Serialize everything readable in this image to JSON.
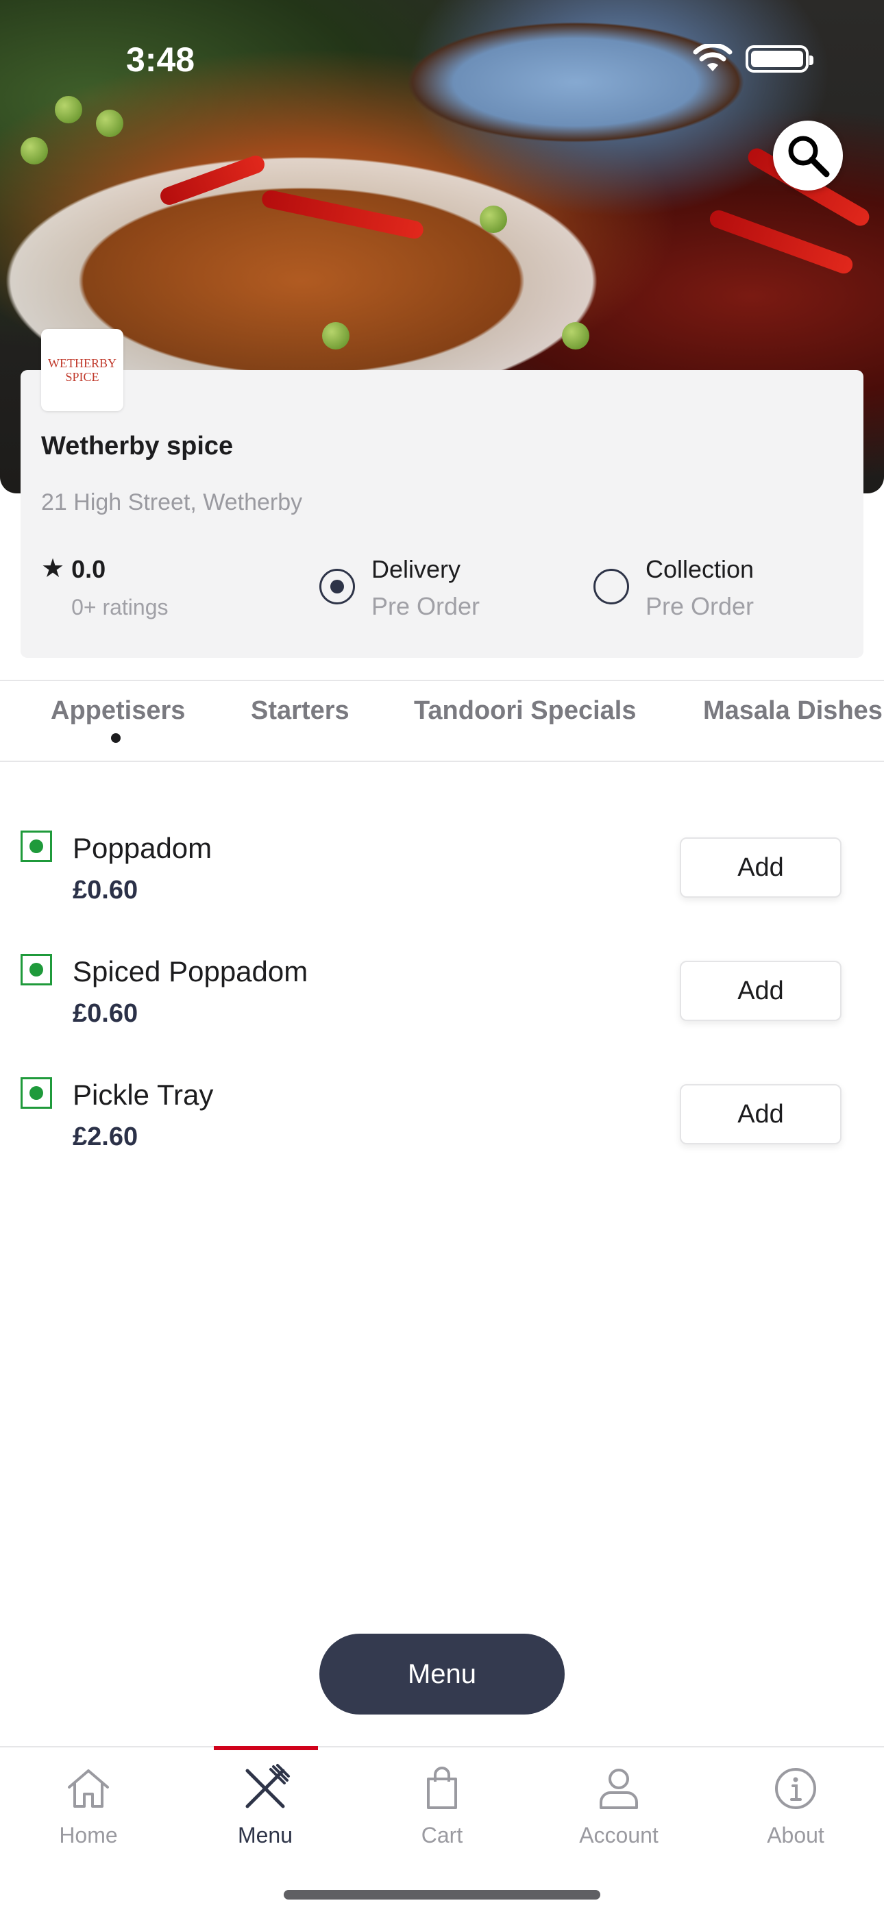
{
  "status_bar": {
    "time": "3:48"
  },
  "restaurant": {
    "logo_text": "WETHERBY SPICE",
    "name": "Wetherby spice",
    "address": "21 High Street, Wetherby",
    "rating_value": "0.0",
    "rating_count": "0+ ratings"
  },
  "order_options": [
    {
      "label": "Delivery",
      "sub": "Pre Order",
      "selected": true
    },
    {
      "label": "Collection",
      "sub": "Pre Order",
      "selected": false
    }
  ],
  "category_tabs": [
    {
      "label": "Appetisers",
      "active": true
    },
    {
      "label": "Starters",
      "active": false
    },
    {
      "label": "Tandoori Specials",
      "active": false
    },
    {
      "label": "Masala Dishes",
      "active": false
    }
  ],
  "menu_items": [
    {
      "name": "Poppadom",
      "price": "£0.60",
      "button": "Add"
    },
    {
      "name": "Spiced Poppadom",
      "price": "£0.60",
      "button": "Add"
    },
    {
      "name": "Pickle Tray",
      "price": "£2.60",
      "button": "Add"
    }
  ],
  "menu_button": "Menu",
  "bottom_nav": [
    {
      "label": "Home",
      "icon": "home-icon",
      "active": false
    },
    {
      "label": "Menu",
      "icon": "fork-knife-icon",
      "active": true
    },
    {
      "label": "Cart",
      "icon": "shopping-bag-icon",
      "active": false
    },
    {
      "label": "Account",
      "icon": "person-icon",
      "active": false
    },
    {
      "label": "About",
      "icon": "info-icon",
      "active": false
    }
  ],
  "colors": {
    "accent_dark": "#343a4f",
    "active_nav_bar": "#d0021b",
    "veg_indicator": "#1f9a3b"
  }
}
